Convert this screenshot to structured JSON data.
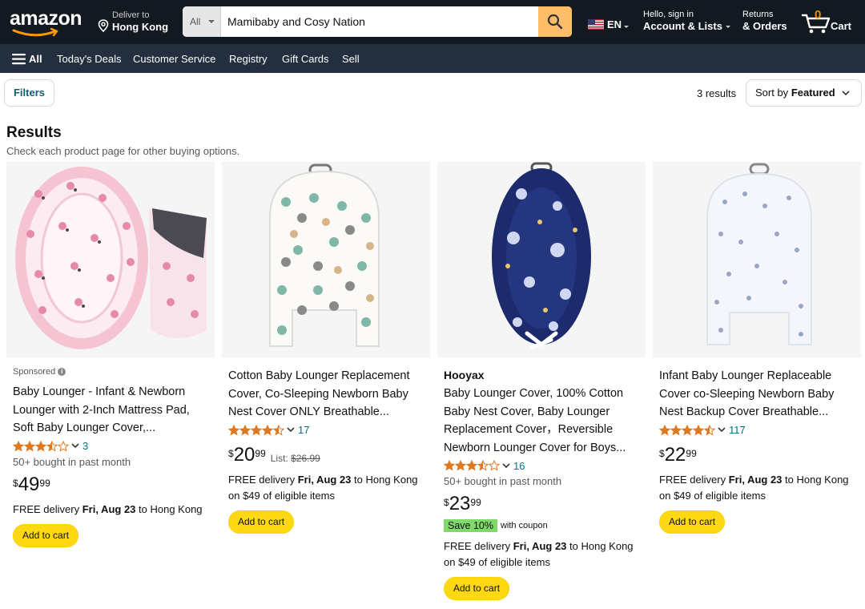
{
  "header": {
    "logo_text": "amazon",
    "deliver_line1": "Deliver to",
    "deliver_line2": "Hong Kong",
    "search_category": "All",
    "search_value": "Mamibaby and Cosy Nation",
    "lang": "EN",
    "account_line1": "Hello, sign in",
    "account_line2": "Account & Lists",
    "returns_line1": "Returns",
    "returns_line2": "& Orders",
    "cart_count": "0",
    "cart_label": "Cart"
  },
  "subnav": {
    "all_label": "All",
    "items": [
      "Today's Deals",
      "Customer Service",
      "Registry",
      "Gift Cards",
      "Sell"
    ]
  },
  "toolbar": {
    "filters_label": "Filters",
    "results_count": "3 results",
    "sort_prefix": "Sort by",
    "sort_value": "Featured"
  },
  "results": {
    "title": "Results",
    "subtitle": "Check each product page for other buying options."
  },
  "products": [
    {
      "sponsored": "Sponsored",
      "brand": "",
      "title": "Baby Lounger - Infant & Newborn Lounger with 2-Inch Mattress Pad, Soft Baby Lounger Cover,...",
      "rating": 3.5,
      "rating_count": "3",
      "bought": "50+ bought in past month",
      "price_symbol": "$",
      "price_whole": "49",
      "price_fraction": "99",
      "list_label": "",
      "list_price": "",
      "coupon": "",
      "coupon_sub": "",
      "delivery_prefix": "FREE delivery",
      "delivery_date": "Fri, Aug 23",
      "delivery_suffix": "to Hong Kong",
      "delivery_line2": "",
      "add_label": "Add to cart"
    },
    {
      "sponsored": "",
      "brand": "",
      "title": "Cotton Baby Lounger Replacement Cover, Co-Sleeping Newborn Baby Nest Cover ONLY Breathable...",
      "rating": 4.5,
      "rating_count": "17",
      "bought": "",
      "price_symbol": "$",
      "price_whole": "20",
      "price_fraction": "99",
      "list_label": "List:",
      "list_price": "$26.99",
      "coupon": "",
      "coupon_sub": "",
      "delivery_prefix": "FREE delivery",
      "delivery_date": "Fri, Aug 23",
      "delivery_suffix": "to Hong Kong",
      "delivery_line2": "on $49 of eligible items",
      "add_label": "Add to cart"
    },
    {
      "sponsored": "",
      "brand": "Hooyax",
      "title": "Baby Lounger Cover, 100% Cotton Baby Nest Cover, Baby Lounger Replacement Cover，Reversible Newborn Lounger Cover for Boys...",
      "rating": 3.5,
      "rating_count": "16",
      "bought": "50+ bought in past month",
      "price_symbol": "$",
      "price_whole": "23",
      "price_fraction": "99",
      "list_label": "",
      "list_price": "",
      "coupon": "Save 10%",
      "coupon_sub": "with coupon",
      "delivery_prefix": "FREE delivery",
      "delivery_date": "Fri, Aug 23",
      "delivery_suffix": "to Hong Kong",
      "delivery_line2": "on $49 of eligible items",
      "add_label": "Add to cart"
    },
    {
      "sponsored": "",
      "brand": "",
      "title": "Infant Baby Lounger Replaceable Cover co-Sleeping Newborn Baby Nest Backup Cover Breathable...",
      "rating": 4.5,
      "rating_count": "117",
      "bought": "",
      "price_symbol": "$",
      "price_whole": "22",
      "price_fraction": "99",
      "list_label": "",
      "list_price": "",
      "coupon": "",
      "coupon_sub": "",
      "delivery_prefix": "FREE delivery",
      "delivery_date": "Fri, Aug 23",
      "delivery_suffix": "to Hong Kong",
      "delivery_line2": "on $49 of eligible items",
      "add_label": "Add to cart"
    }
  ],
  "colors": {
    "nav_dark": "#131921",
    "nav_sub": "#232f3e",
    "search_button": "#febd69",
    "star": "#de7921",
    "link": "#007185",
    "add_button": "#ffd814",
    "coupon": "#7fda69",
    "cart_count": "#f08804"
  },
  "icons": {
    "location": "map-pin-icon",
    "search": "magnifier-icon",
    "flag": "us-flag-icon",
    "cart": "cart-icon",
    "menu": "hamburger-icon",
    "sort": "chevron-down-icon",
    "info": "info-icon"
  }
}
